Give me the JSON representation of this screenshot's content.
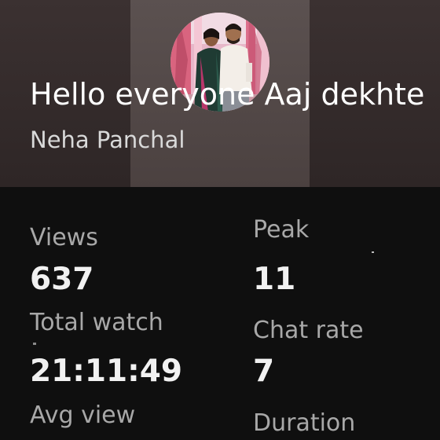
{
  "live": {
    "title": "Hello everyone Aaj dekhte",
    "channel": "Neha Panchal"
  },
  "stats": {
    "views_label": "Views",
    "views_value": "637",
    "peak_label": "Peak",
    "peak_value": "11",
    "watch_label": "Total watch",
    "watch_value": "21:11:49",
    "chat_label": "Chat rate",
    "chat_value": "7",
    "avg_label": "Avg view",
    "duration_label": "Duration"
  },
  "colors": {
    "background": "#0f0f0f",
    "text_primary": "#ffffff",
    "text_secondary": "#a8a8a8"
  }
}
